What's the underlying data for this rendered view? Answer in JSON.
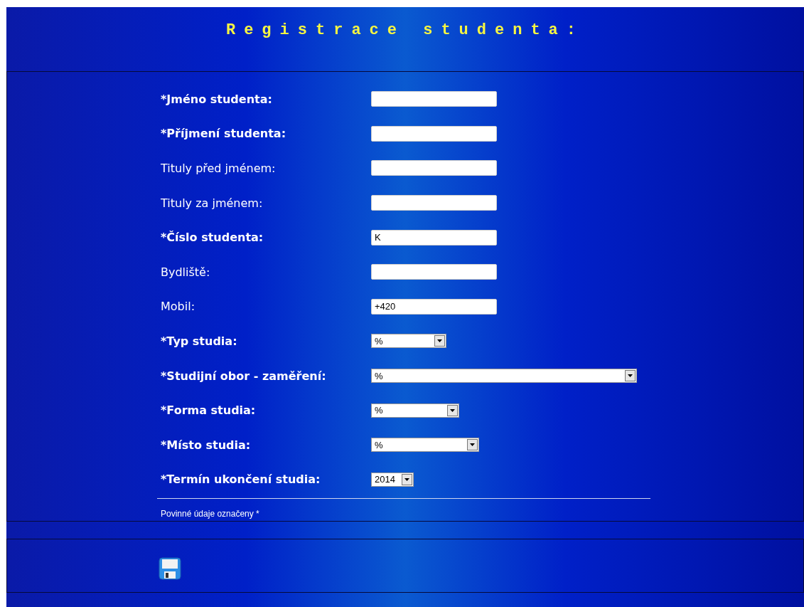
{
  "title": "Registrace studenta:",
  "fields": [
    {
      "label": "*Jméno studenta:",
      "required": true,
      "kind": "text"
    },
    {
      "label": "*Příjmení studenta:",
      "required": true,
      "kind": "text"
    },
    {
      "label": "Tituly před jménem:",
      "required": false,
      "kind": "text"
    },
    {
      "label": "Tituly za jménem:",
      "required": false,
      "kind": "text"
    },
    {
      "label": "*Číslo studenta:",
      "required": true,
      "kind": "text",
      "value": "K"
    },
    {
      "label": "Bydliště:",
      "required": false,
      "kind": "text"
    },
    {
      "label": "Mobil:",
      "required": false,
      "kind": "text",
      "value": "+420"
    },
    {
      "label": "*Typ studia:",
      "required": true,
      "kind": "select",
      "value": "%"
    },
    {
      "label": "*Studijní obor - zaměření:",
      "required": true,
      "kind": "select",
      "value": "%"
    },
    {
      "label": "*Forma studia:",
      "required": true,
      "kind": "select",
      "value": "%"
    },
    {
      "label": "*Místo studia:",
      "required": true,
      "kind": "select",
      "value": "%"
    },
    {
      "label": "*Termín ukončení studia:",
      "required": true,
      "kind": "select",
      "value": "2014"
    }
  ],
  "note": "Povinné údaje označeny *"
}
